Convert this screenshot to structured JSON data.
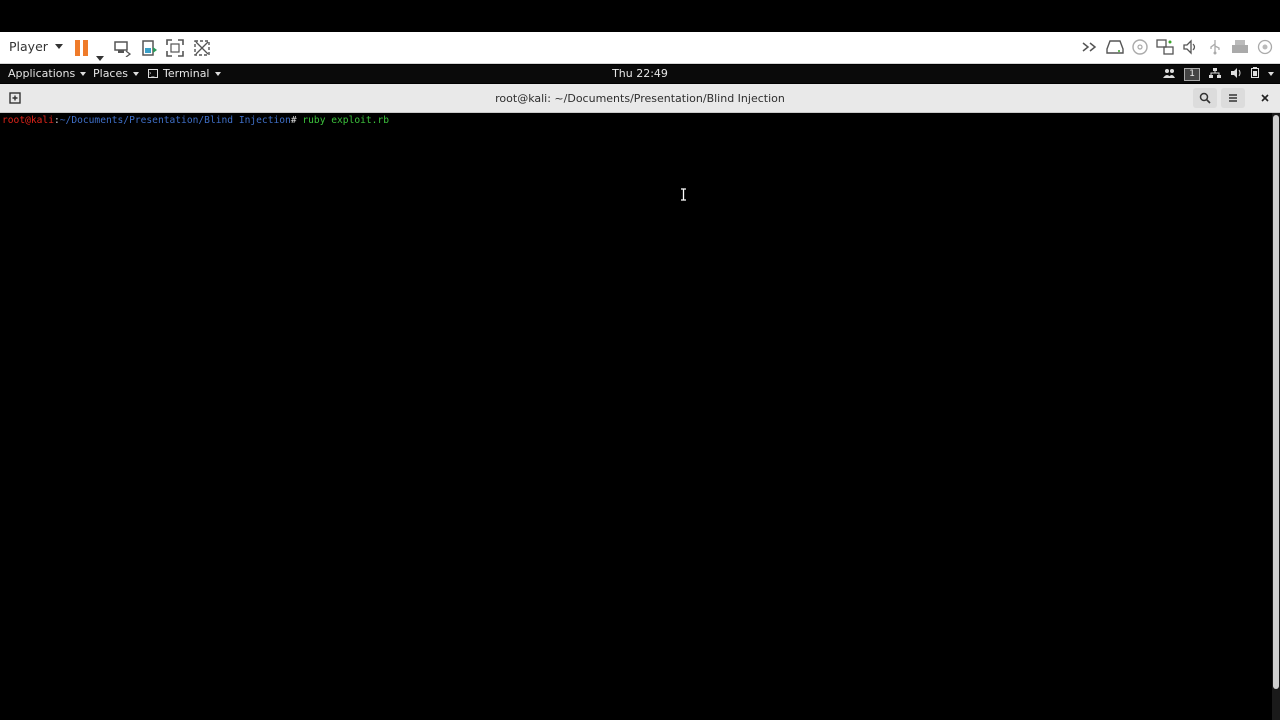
{
  "vm_toolbar": {
    "player_label": "Player",
    "icons": [
      "pause-icon",
      "send-ctrl-alt-del-icon",
      "removable-devices-icon",
      "fullscreen-icon",
      "unity-icon"
    ],
    "right_icons": [
      "more-devices-icon",
      "hard-disk-icon",
      "cd-dvd-icon",
      "network-adapter-icon",
      "sound-card-icon",
      "usb-icon",
      "printer-icon",
      "display-icon"
    ],
    "accent_color": "#ef7b2a"
  },
  "gnome_panel": {
    "applications_label": "Applications",
    "places_label": "Places",
    "terminal_label": "Terminal",
    "clock": "Thu 22:49",
    "workspace_number": "1"
  },
  "terminal": {
    "title": "root@kali: ~/Documents/Presentation/Blind Injection",
    "prompt_user": "root@kali",
    "prompt_sep": ":",
    "prompt_path": "~/Documents/Presentation/Blind Injection",
    "prompt_symbol": "#",
    "command": "ruby exploit.rb",
    "colors": {
      "user": "#e0241a",
      "path": "#3f6fc7",
      "command": "#3cc13c",
      "background": "#000000"
    }
  }
}
